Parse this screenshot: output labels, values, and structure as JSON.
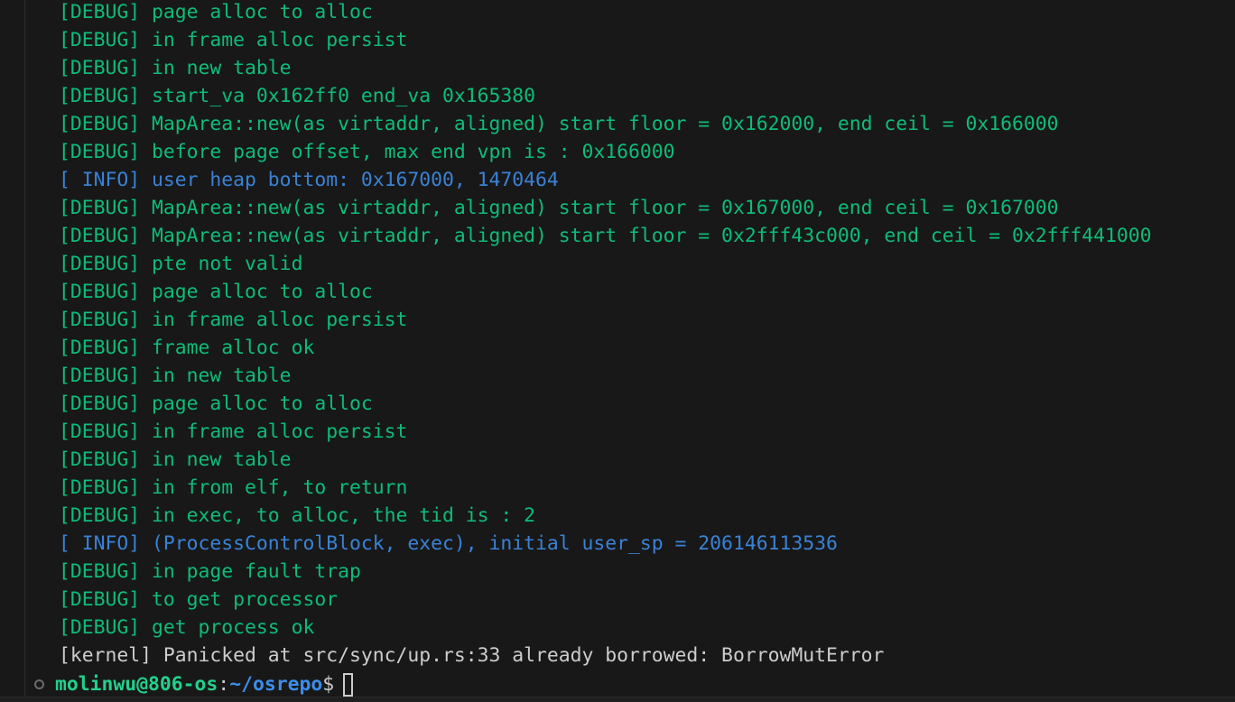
{
  "terminal": {
    "lines": [
      {
        "level": "debug",
        "text": "[DEBUG] page alloc to alloc"
      },
      {
        "level": "debug",
        "text": "[DEBUG] in frame alloc persist"
      },
      {
        "level": "debug",
        "text": "[DEBUG] in new table"
      },
      {
        "level": "debug",
        "text": "[DEBUG] start_va 0x162ff0 end_va 0x165380"
      },
      {
        "level": "debug",
        "text": "[DEBUG] MapArea::new(as virtaddr, aligned) start floor = 0x162000, end ceil = 0x166000"
      },
      {
        "level": "debug",
        "text": "[DEBUG] before page offset, max end vpn is : 0x166000"
      },
      {
        "level": "info",
        "text": "[ INFO] user heap bottom: 0x167000, 1470464"
      },
      {
        "level": "debug",
        "text": "[DEBUG] MapArea::new(as virtaddr, aligned) start floor = 0x167000, end ceil = 0x167000"
      },
      {
        "level": "debug",
        "text": "[DEBUG] MapArea::new(as virtaddr, aligned) start floor = 0x2fff43c000, end ceil = 0x2fff441000"
      },
      {
        "level": "debug",
        "text": "[DEBUG] pte not valid"
      },
      {
        "level": "debug",
        "text": "[DEBUG] page alloc to alloc"
      },
      {
        "level": "debug",
        "text": "[DEBUG] in frame alloc persist"
      },
      {
        "level": "debug",
        "text": "[DEBUG] frame alloc ok"
      },
      {
        "level": "debug",
        "text": "[DEBUG] in new table"
      },
      {
        "level": "debug",
        "text": "[DEBUG] page alloc to alloc"
      },
      {
        "level": "debug",
        "text": "[DEBUG] in frame alloc persist"
      },
      {
        "level": "debug",
        "text": "[DEBUG] in new table"
      },
      {
        "level": "debug",
        "text": "[DEBUG] in from elf, to return"
      },
      {
        "level": "debug",
        "text": "[DEBUG] in exec, to alloc, the tid is : 2"
      },
      {
        "level": "info",
        "text": "[ INFO] (ProcessControlBlock, exec), initial user_sp = 206146113536"
      },
      {
        "level": "debug",
        "text": "[DEBUG] in page fault trap"
      },
      {
        "level": "debug",
        "text": "[DEBUG] to get processor"
      },
      {
        "level": "debug",
        "text": "[DEBUG] get process ok"
      },
      {
        "level": "plain",
        "text": "[kernel] Panicked at src/sync/up.rs:33 already borrowed: BorrowMutError"
      }
    ],
    "prompt": {
      "user_host": "molinwu@806-os",
      "separator": ":",
      "path": "~/osrepo",
      "symbol": "$"
    }
  },
  "colors": {
    "background": "#181818",
    "debug": "#0dbc79",
    "info": "#3a82d6",
    "plain": "#cccccc",
    "prompt_user": "#23d18b",
    "prompt_path": "#3b8eea"
  },
  "icons": {
    "status": "circle-outline-icon",
    "cursor": "block-cursor-icon"
  }
}
